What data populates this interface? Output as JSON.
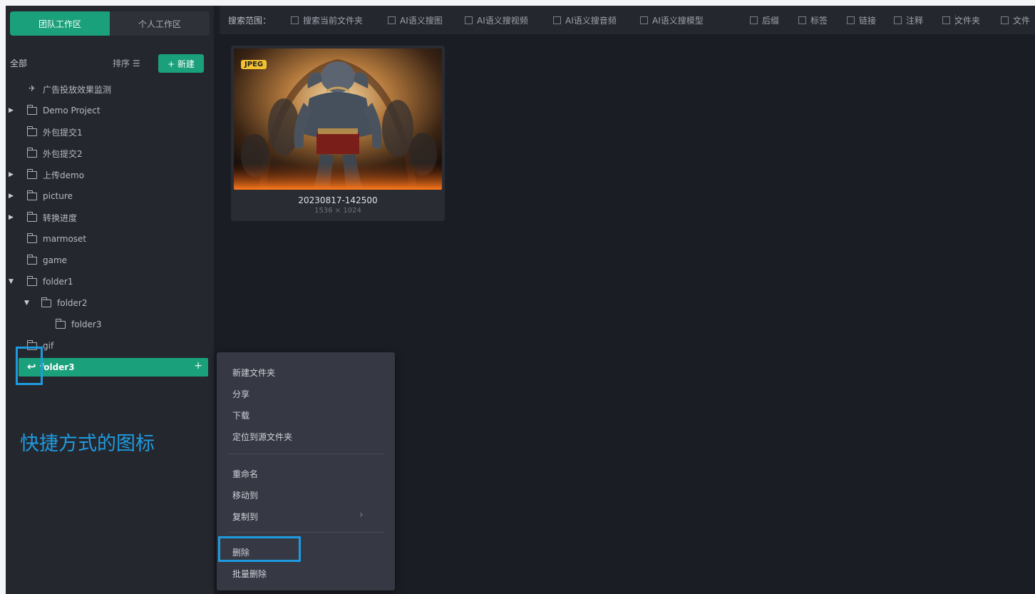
{
  "workspace_tabs": [
    "团队工作区",
    "个人工作区"
  ],
  "sidebar": {
    "all_label": "全部",
    "sort_label": "排序 ☰",
    "new_button": "+ 新建",
    "tree": [
      {
        "label": "广告投放效果监测",
        "icon": "pin-icon"
      },
      {
        "label": "Demo Project",
        "icon": "folder-icon",
        "expander": "collapsed"
      },
      {
        "label": "外包提交1",
        "icon": "folder-icon"
      },
      {
        "label": "外包提交2",
        "icon": "folder-icon"
      },
      {
        "label": "上传demo",
        "icon": "folder-icon",
        "expander": "collapsed"
      },
      {
        "label": "picture",
        "icon": "folder-icon",
        "expander": "collapsed"
      },
      {
        "label": "转换进度",
        "icon": "folder-icon",
        "expander": "collapsed"
      },
      {
        "label": "marmoset",
        "icon": "folder-icon"
      },
      {
        "label": "game",
        "icon": "folder-icon"
      },
      {
        "label": "folder1",
        "icon": "folder-icon",
        "expander": "expanded"
      },
      {
        "label": "folder2",
        "icon": "folder-icon",
        "expander": "expanded"
      },
      {
        "label": "folder3",
        "icon": "folder-icon"
      },
      {
        "label": "gif",
        "icon": "folder-icon"
      },
      {
        "label": "folder3",
        "icon": "shortcut-icon",
        "selected": true
      }
    ]
  },
  "annotation": "快捷方式的图标",
  "filter_bar": {
    "label": "搜索范围：",
    "options": [
      "搜索当前文件夹",
      "AI语义搜图",
      "AI语义搜视频",
      "AI语义搜音频",
      "AI语义搜模型",
      "后缀",
      "标签",
      "链接",
      "注释",
      "文件夹",
      "文件"
    ]
  },
  "card": {
    "badge": "JPEG",
    "name": "20230817-142500",
    "dimensions": "1536 × 1024"
  },
  "context_menu": {
    "items": [
      "新建文件夹",
      "分享",
      "下载",
      "定位到源文件夹",
      "重命名",
      "移动到",
      "复制到",
      "删除",
      "批量删除"
    ],
    "submenu_chevron": "›"
  },
  "colors": {
    "accent": "#1aa07a",
    "highlight": "#1e9be0",
    "badge": "#f2c230"
  }
}
